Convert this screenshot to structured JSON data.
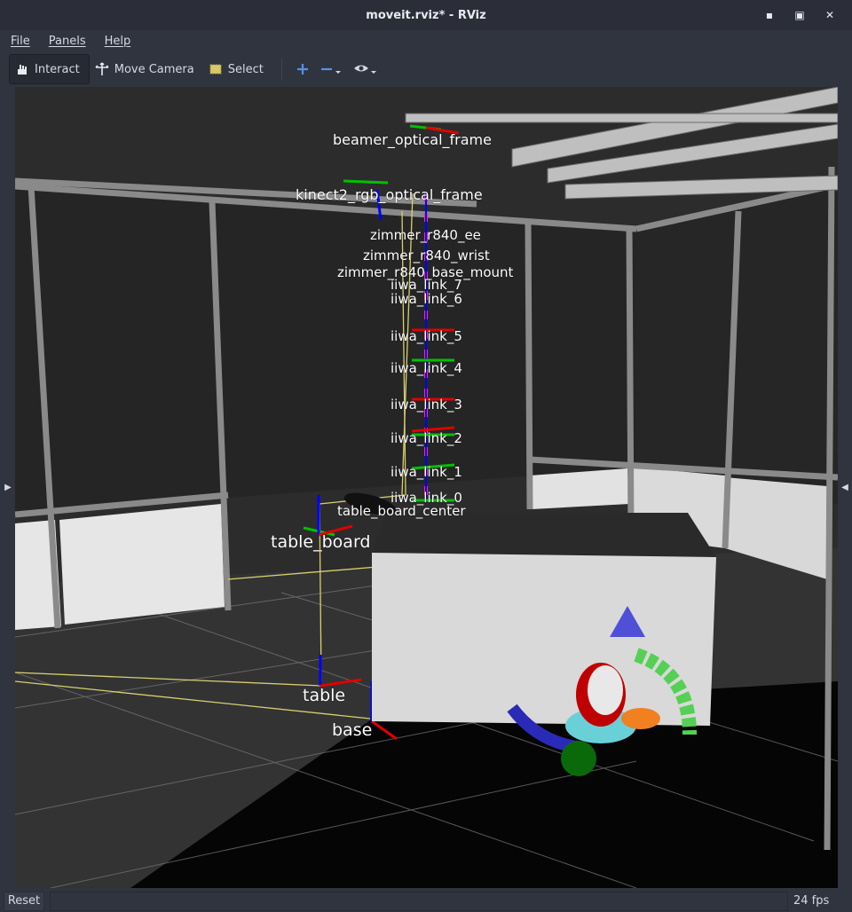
{
  "window": {
    "title": "moveit.rviz* - RViz",
    "minimize": "▪",
    "maximize": "▣",
    "close": "✕"
  },
  "menu": {
    "items": [
      "File",
      "Panels",
      "Help"
    ]
  },
  "toolbar": {
    "interact_label": "Interact",
    "move_camera_label": "Move Camera",
    "select_label": "Select",
    "add_icon": "plus-icon",
    "remove_icon": "minus-icon",
    "view_icon": "eye-icon"
  },
  "scene": {
    "frame_labels": {
      "beamer": "beamer_optical_frame",
      "kinect": "kinect2_rgb_optical_frame",
      "zimmer_ee": "zimmer_r840_ee",
      "zimmer_wrist": "zimmer_r840_wrist",
      "zimmer_mount": "zimmer_r840_base_mount",
      "iiwa_link_7": "iiwa_link_7",
      "iiwa_link_6": "iiwa_link_6",
      "iiwa_link_5": "iiwa_link_5",
      "iiwa_link_4": "iiwa_link_4",
      "iiwa_link_3": "iiwa_link_3",
      "iiwa_link_2": "iiwa_link_2",
      "iiwa_link_1": "iiwa_link_1",
      "iiwa_link_0": "iiwa_link_0",
      "table_board_center": "table_board_center",
      "table_board": "table_board",
      "table": "table",
      "base": "base"
    },
    "colors": {
      "x_axis": "#e00000",
      "y_axis": "#00c000",
      "z_axis": "#0000ff",
      "tf_line": "#e8e070",
      "box": "#d8d8d8",
      "floor": "#000000",
      "grid": "#8a8a8a"
    }
  },
  "status": {
    "reset_label": "Reset",
    "fps": "24 fps"
  }
}
